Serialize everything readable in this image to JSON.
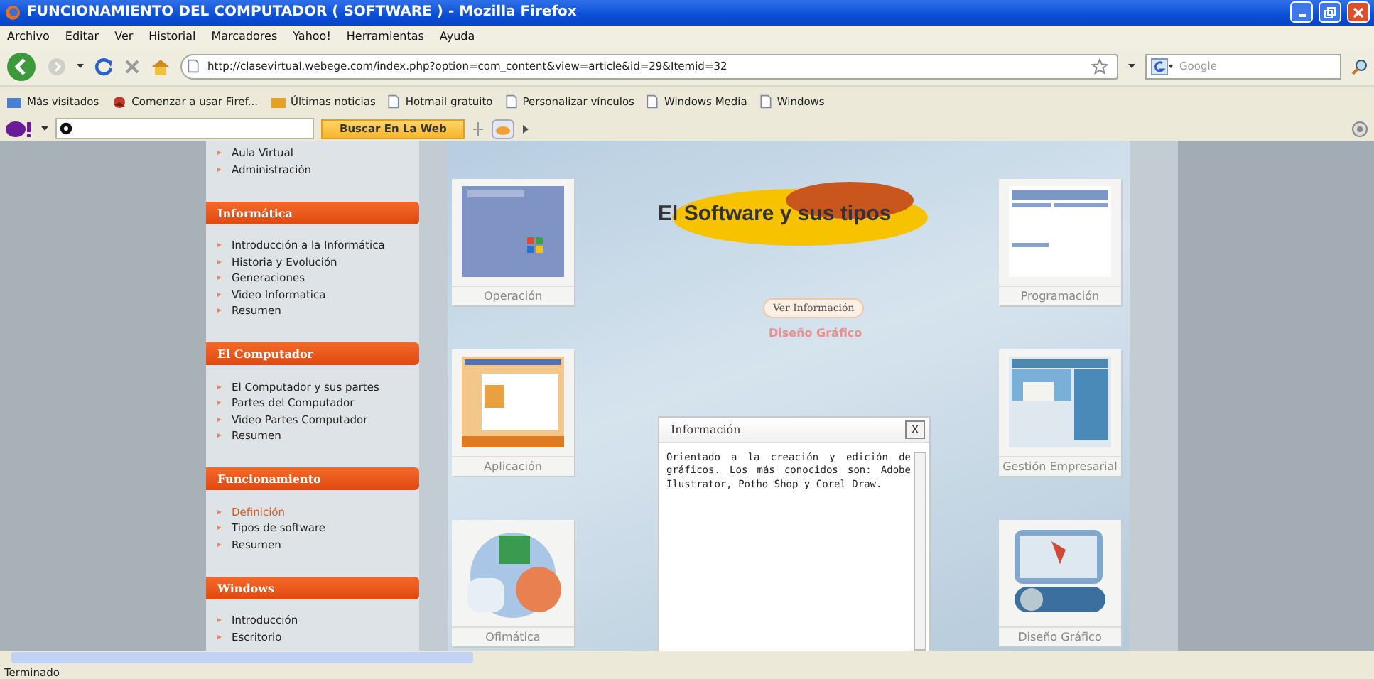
{
  "window": {
    "title": "FUNCIONAMIENTO DEL COMPUTADOR ( SOFTWARE ) - Mozilla Firefox"
  },
  "menu": [
    "Archivo",
    "Editar",
    "Ver",
    "Historial",
    "Marcadores",
    "Yahoo!",
    "Herramientas",
    "Ayuda"
  ],
  "navigation": {
    "url": "http://clasevirtual.webege.com/index.php?option=com_content&view=article&id=29&Itemid=32",
    "search_placeholder": "Google"
  },
  "bookmarks": [
    {
      "label": "Más visitados",
      "kind": "folder"
    },
    {
      "label": "Comenzar a usar Firef...",
      "kind": "firefox"
    },
    {
      "label": "Últimas noticias",
      "kind": "feed"
    },
    {
      "label": "Hotmail gratuito",
      "kind": "page"
    },
    {
      "label": "Personalizar vínculos",
      "kind": "page"
    },
    {
      "label": "Windows Media",
      "kind": "page"
    },
    {
      "label": "Windows",
      "kind": "page"
    }
  ],
  "yahoo_toolbar": {
    "search_button": "Buscar En La Web"
  },
  "sidebar": {
    "top_items": [
      {
        "label": "Aula Virtual",
        "selected": false
      },
      {
        "label": "Administración",
        "selected": false
      }
    ],
    "sections": [
      {
        "title": "Informática",
        "items": [
          {
            "label": "Introducción a la Informática",
            "selected": false
          },
          {
            "label": "Historia y Evolución",
            "selected": false
          },
          {
            "label": "Generaciones",
            "selected": false
          },
          {
            "label": "Video Informatica",
            "selected": false
          },
          {
            "label": "Resumen",
            "selected": false
          }
        ]
      },
      {
        "title": "El Computador",
        "items": [
          {
            "label": "El Computador y sus partes",
            "selected": false
          },
          {
            "label": "Partes del Computador",
            "selected": false
          },
          {
            "label": "Video Partes Computador",
            "selected": false
          },
          {
            "label": "Resumen",
            "selected": false
          }
        ]
      },
      {
        "title": "Funcionamiento",
        "items": [
          {
            "label": "Definición",
            "selected": true
          },
          {
            "label": "Tipos de software",
            "selected": false
          },
          {
            "label": "Resumen",
            "selected": false
          }
        ]
      },
      {
        "title": "Windows",
        "items": [
          {
            "label": "Introducción",
            "selected": false
          },
          {
            "label": "Escritorio",
            "selected": false
          }
        ]
      }
    ]
  },
  "content": {
    "title": "El Software y sus tipos",
    "info_button": "Ver Información",
    "category": "Diseño Gráfico",
    "cards": [
      {
        "label": "Operación",
        "kind": "windows"
      },
      {
        "label": "Aplicación",
        "kind": "office"
      },
      {
        "label": "Ofimática",
        "kind": "suite"
      },
      {
        "label": "Programación",
        "kind": "webpage"
      },
      {
        "label": "Gestión Empresarial",
        "kind": "business"
      },
      {
        "label": "Diseño Gráfico",
        "kind": "design"
      }
    ],
    "dialog": {
      "title": "Información",
      "close": "X",
      "text": "Orientado a la creación y edición de gráficos. Los más conocidos son: Adobe Ilustrator, Potho Shop y Corel Draw."
    }
  },
  "status_bar": {
    "text": "Terminado"
  }
}
